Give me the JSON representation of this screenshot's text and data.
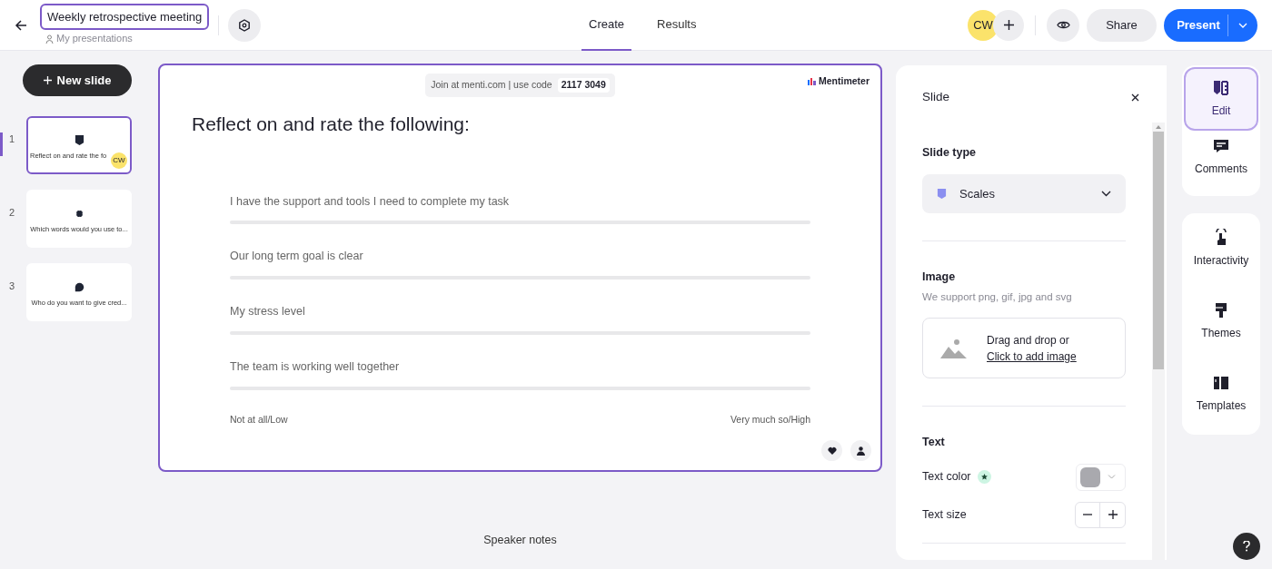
{
  "header": {
    "title_value": "Weekly retrospective meeting",
    "breadcrumb": "My presentations",
    "tabs": [
      {
        "label": "Create",
        "selected": true
      },
      {
        "label": "Results",
        "selected": false
      }
    ],
    "avatar": "CW",
    "share": "Share",
    "present": "Present"
  },
  "sidebar": {
    "new_slide": "New slide",
    "slides": [
      {
        "number": "1",
        "title": "Reflect on and rate the fo",
        "kind": "scales",
        "selected": true,
        "collaborator": "CW"
      },
      {
        "number": "2",
        "title": "Which words would you use to...",
        "kind": "wordcloud",
        "selected": false
      },
      {
        "number": "3",
        "title": "Who do you want to give cred...",
        "kind": "open",
        "selected": false
      }
    ]
  },
  "slide": {
    "join_text": "Join at menti.com | use code",
    "code": "2117 3049",
    "brand": "Mentimeter",
    "question": "Reflect on and rate the following:",
    "statements": [
      "I have the support and tools I need to complete my task",
      "Our long term goal is clear",
      "My stress level",
      "The team is working well together"
    ],
    "scale_min": "Not at all/Low",
    "scale_max": "Very much so/High"
  },
  "speaker_notes": "Speaker notes",
  "panel": {
    "title": "Slide",
    "slide_type_label": "Slide type",
    "slide_type_value": "Scales",
    "image_heading": "Image",
    "image_hint": "We support png, gif, jpg and svg",
    "drop_text": "Drag and drop or",
    "drop_link": "Click to add image",
    "text_heading": "Text",
    "text_color": {
      "label": "Text color",
      "color": "#a9a9ae"
    },
    "text_size_label": "Text size"
  },
  "rail_groups": [
    [
      {
        "label": "Edit",
        "kind": "edit",
        "selected": true
      },
      {
        "label": "Comments",
        "kind": "comments",
        "selected": false
      }
    ],
    [
      {
        "label": "Interactivity",
        "kind": "interactivity",
        "selected": false
      },
      {
        "label": "Themes",
        "kind": "themes",
        "selected": false
      },
      {
        "label": "Templates",
        "kind": "templates",
        "selected": false
      }
    ]
  ]
}
